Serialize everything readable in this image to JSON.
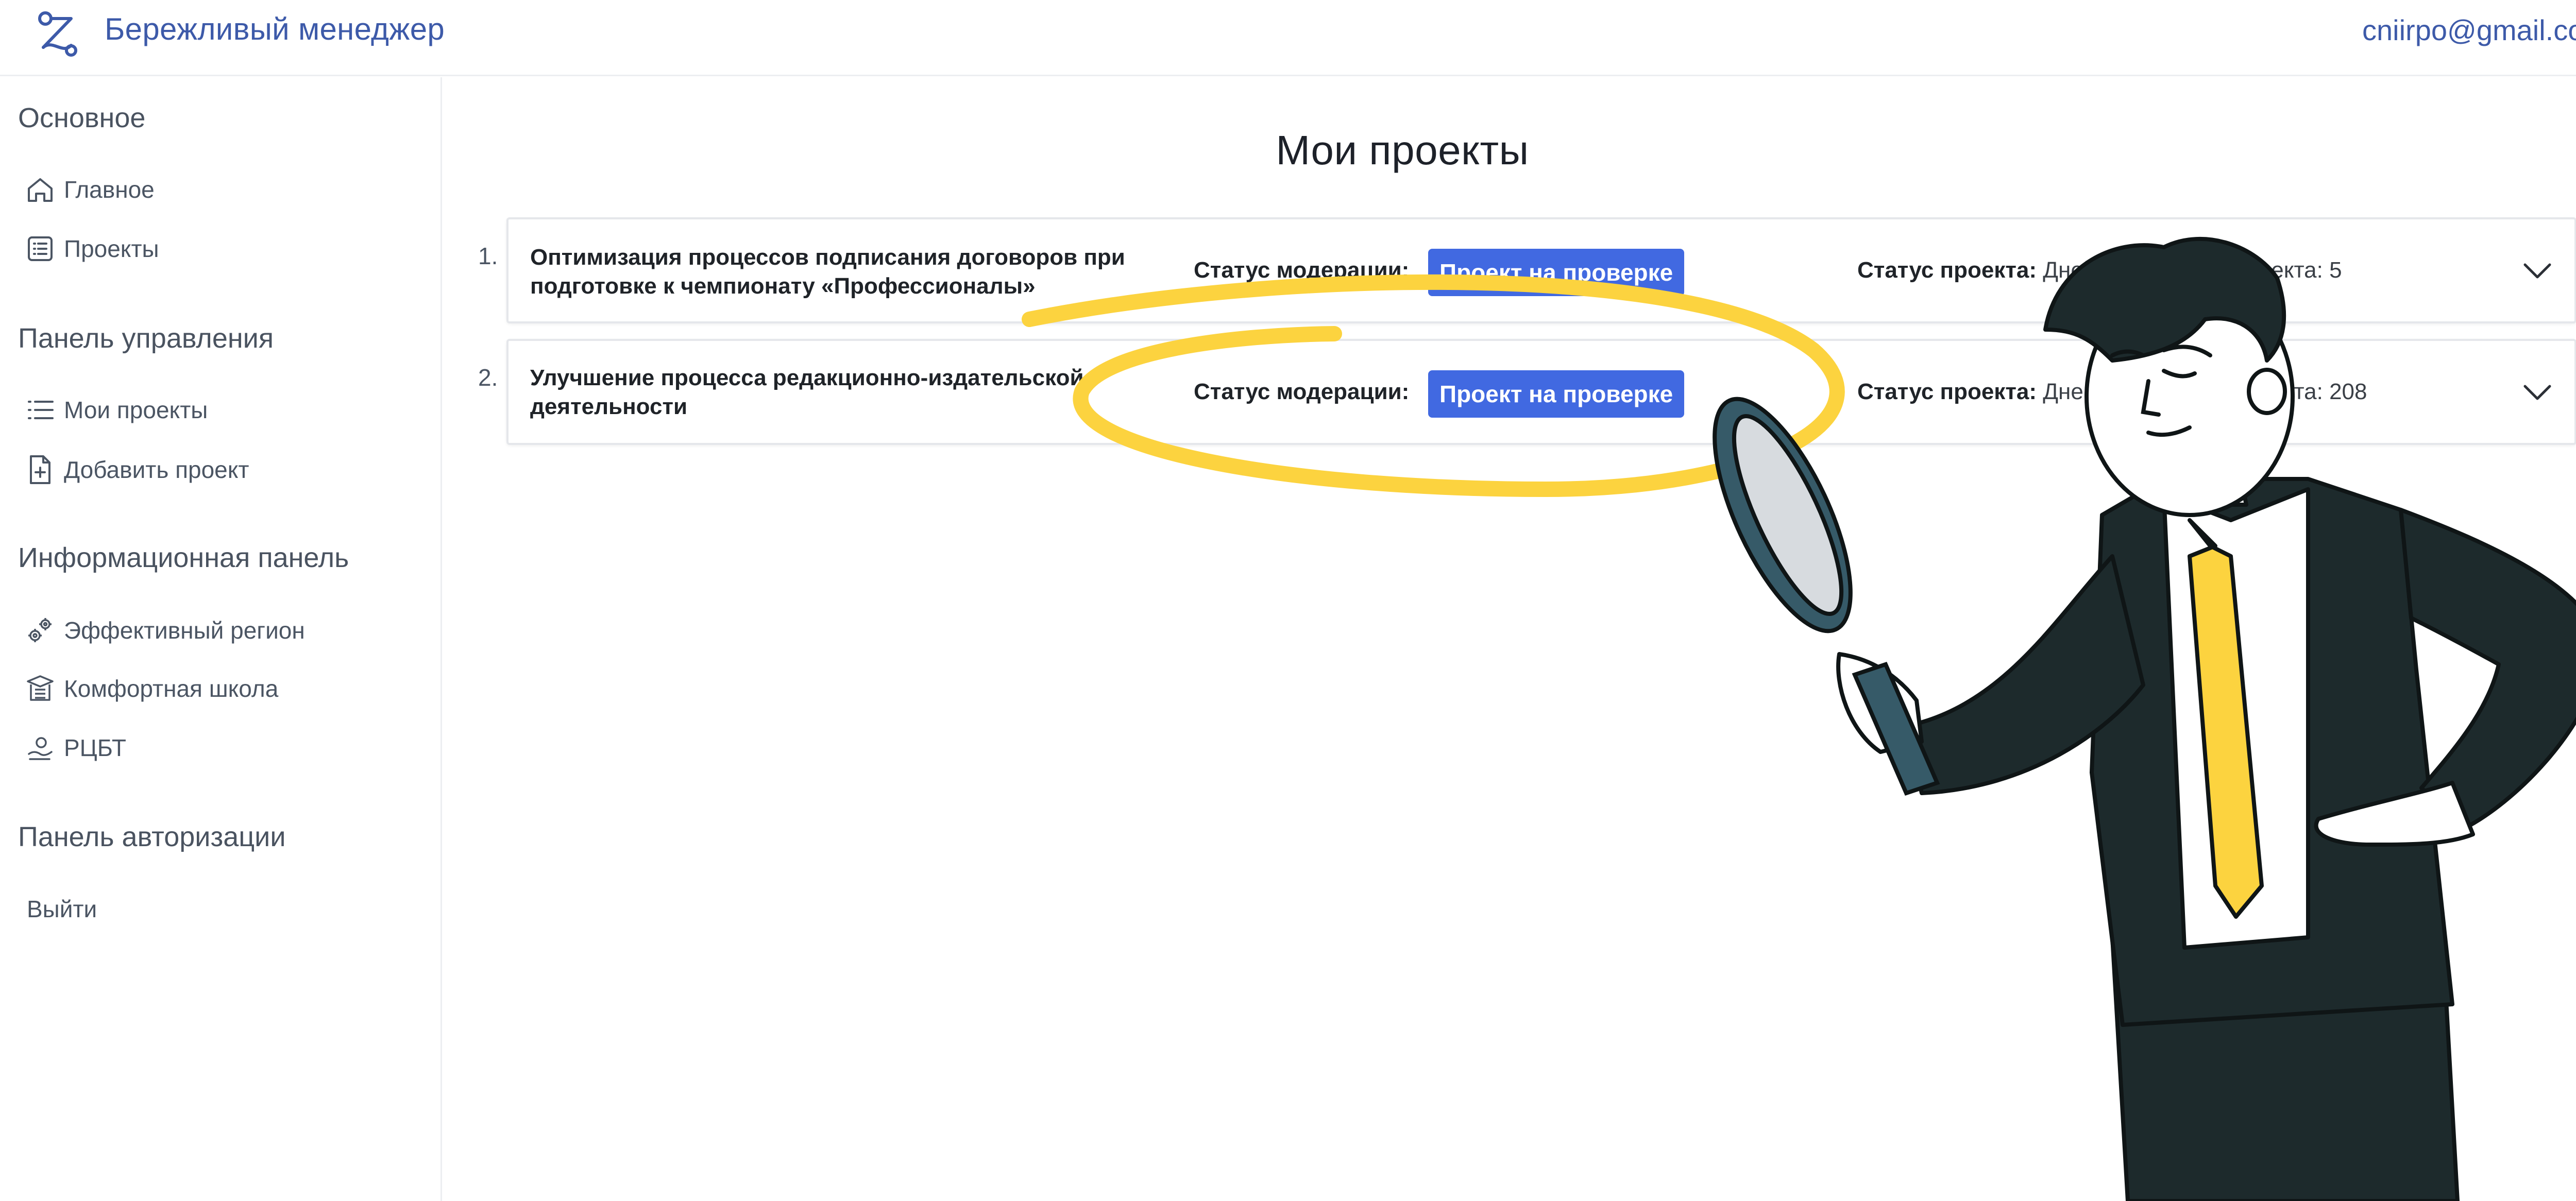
{
  "header": {
    "app_title": "Бережливый менеджер",
    "user_email": "cniirpo@gmail.com",
    "logo_icon": "lean-logo-icon",
    "accent_color": "#3d5aa9"
  },
  "sidebar": {
    "sections": [
      {
        "title": "Основное",
        "items": [
          {
            "label": "Главное",
            "icon": "home-icon"
          },
          {
            "label": "Проекты",
            "icon": "list-box-icon"
          }
        ]
      },
      {
        "title": "Панель управления",
        "items": [
          {
            "label": "Мои проекты",
            "icon": "bullet-list-icon"
          },
          {
            "label": "Добавить проект",
            "icon": "add-document-icon"
          }
        ]
      },
      {
        "title": "Информационная панель",
        "items": [
          {
            "label": "Эффективный регион",
            "icon": "gears-icon"
          },
          {
            "label": "Комфортная школа",
            "icon": "school-icon"
          },
          {
            "label": "РЦБТ",
            "icon": "rcbt-icon"
          }
        ]
      },
      {
        "title": "Панель авторизации",
        "items": [
          {
            "label": "Выйти",
            "icon": ""
          }
        ]
      }
    ]
  },
  "main": {
    "page_title": "Мои проекты",
    "moderation_label": "Статус модерации:",
    "project_status_label": "Статус проекта:",
    "badge_color": "#4169e1",
    "projects": [
      {
        "index": "1.",
        "name": "Оптимизация процессов подписания договоров при подготовке к чемпионату «Профессионалы»",
        "moderation_status": "Проект на проверке",
        "project_status_value": "Дней реализации проекта: 5"
      },
      {
        "index": "2.",
        "name": "Улучшение процесса редакционно-издательской деятельности",
        "moderation_status": "Проект на проверке",
        "project_status_value": "Дней реализации проекта: 208"
      }
    ]
  },
  "illustration": {
    "subject": "businessman-with-magnifying-glass-illustration",
    "highlight_color": "#fcd33f",
    "suit_color": "#1d2a2c",
    "tie_color": "#fcd33f"
  }
}
